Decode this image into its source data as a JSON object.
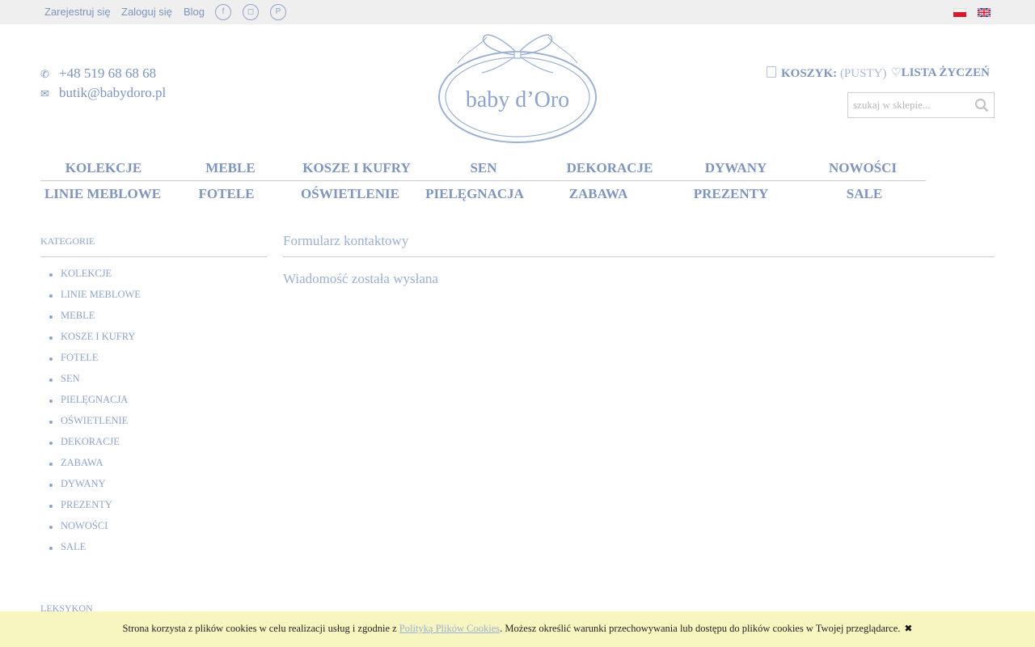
{
  "topbar": {
    "register": "Zarejestruj się",
    "login": "Zaloguj się",
    "blog": "Blog",
    "social": [
      {
        "name": "facebook-icon",
        "glyph": "f"
      },
      {
        "name": "instagram-icon",
        "glyph": "◻"
      },
      {
        "name": "pinterest-icon",
        "glyph": "P"
      }
    ],
    "languages": [
      "pl",
      "en"
    ]
  },
  "header": {
    "phone": "+48 519 68 68 68",
    "email": "butik@babydoro.pl",
    "logo_text": "baby d’Oro",
    "cart_label": "KOSZYK:",
    "cart_status": "(PUSTY)",
    "wishlist_label": "LISTA ŻYCZEŃ",
    "search_placeholder": "szukaj w sklepie..."
  },
  "menu": {
    "row1": [
      "KOLEKCJE",
      "MEBLE",
      "KOSZE I KUFRY",
      "SEN",
      "DEKORACJE",
      "DYWANY",
      "NOWOŚCI"
    ],
    "row2": [
      "LINIE MEBLOWE",
      "FOTELE",
      "OŚWIETLENIE",
      "PIELĘGNACJA",
      "ZABAWA",
      "PREZENTY",
      "SALE"
    ]
  },
  "sidebar": {
    "title": "KATEGORIE",
    "items": [
      "KOLEKCJE",
      "LINIE MEBLOWE",
      "MEBLE",
      "KOSZE I KUFRY",
      "FOTELE",
      "SEN",
      "PIELĘGNACJA",
      "OŚWIETLENIE",
      "DEKORACJE",
      "ZABAWA",
      "DYWANY",
      "PREZENTY",
      "NOWOŚCI",
      "SALE"
    ],
    "second_title": "LEKSYKON"
  },
  "content": {
    "title": "Formularz kontaktowy",
    "message": "Wiadomość została wysłana"
  },
  "cookie": {
    "text_before": "Strona korzysta z plików cookies w celu realizacji usług i zgodnie z ",
    "link_text": "Polityką Plików Cookies",
    "text_after": ". Możesz określić warunki przechowywania lub dostępu do plików cookies w Twojej przeglądarce.",
    "close": "✖"
  },
  "colors": {
    "accent": "#7f95bd",
    "light_accent": "#9cb0d2",
    "topbar_bg": "#efefef",
    "cookie_bg": "#f7f5c0"
  }
}
